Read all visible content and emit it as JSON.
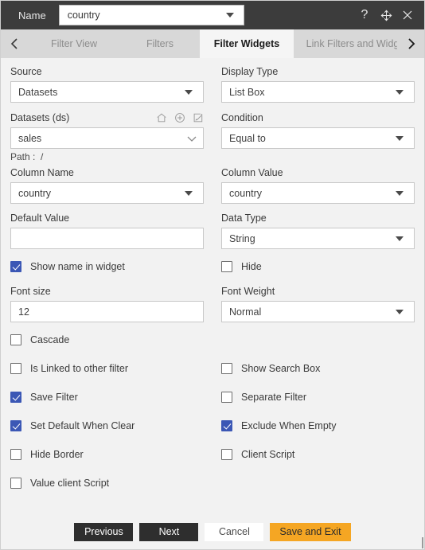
{
  "titlebar": {
    "name_label": "Name",
    "name_value": "country",
    "help_icon": "question-mark-icon",
    "move_icon": "move-arrows-icon",
    "close_icon": "close-icon"
  },
  "tabs": {
    "prev_arrow": "chevron-left-icon",
    "next_arrow": "chevron-right-icon",
    "items": [
      {
        "label": "Filter View",
        "active": false
      },
      {
        "label": "Filters",
        "active": false
      },
      {
        "label": "Filter Widgets",
        "active": true
      },
      {
        "label": "Link Filters and Widge",
        "active": false
      }
    ]
  },
  "form": {
    "source": {
      "label": "Source",
      "value": "Datasets"
    },
    "display_type": {
      "label": "Display Type",
      "value": "List Box"
    },
    "datasets": {
      "label": "Datasets (ds)",
      "value": "sales",
      "path_label": "Path :",
      "path_value": "/",
      "icons": [
        "home-icon",
        "add-circle-icon",
        "edit-icon"
      ]
    },
    "condition": {
      "label": "Condition",
      "value": "Equal to"
    },
    "column_name": {
      "label": "Column Name",
      "value": "country"
    },
    "column_value": {
      "label": "Column Value",
      "value": "country"
    },
    "default_value": {
      "label": "Default Value",
      "value": ""
    },
    "data_type": {
      "label": "Data Type",
      "value": "String"
    },
    "font_size": {
      "label": "Font size",
      "value": "12"
    },
    "font_weight": {
      "label": "Font Weight",
      "value": "Normal"
    }
  },
  "checkboxes": {
    "show_name_in_widget": {
      "label": "Show name in widget",
      "checked": true
    },
    "hide": {
      "label": "Hide",
      "checked": false
    },
    "cascade": {
      "label": "Cascade",
      "checked": false
    },
    "is_linked_to_other_filter": {
      "label": "Is Linked to other filter",
      "checked": false
    },
    "show_search_box": {
      "label": "Show Search Box",
      "checked": false
    },
    "save_filter": {
      "label": "Save Filter",
      "checked": true
    },
    "separate_filter": {
      "label": "Separate Filter",
      "checked": false
    },
    "set_default_when_clear": {
      "label": "Set Default When Clear",
      "checked": true
    },
    "exclude_when_empty": {
      "label": "Exclude When Empty",
      "checked": true
    },
    "hide_border": {
      "label": "Hide Border",
      "checked": false
    },
    "client_script": {
      "label": "Client Script",
      "checked": false
    },
    "value_client_script": {
      "label": "Value client Script",
      "checked": false
    }
  },
  "footer": {
    "previous": "Previous",
    "next": "Next",
    "cancel": "Cancel",
    "save_and_exit": "Save and Exit"
  },
  "colors": {
    "titlebar_bg": "#3c3c3c",
    "tab_bg": "#d8d8d8",
    "active_tab_bg": "#f5f5f5",
    "page_bg": "#f2f2f2",
    "checkbox_checked": "#3b57b5",
    "primary_button": "#2e2e2e",
    "accent_button": "#f5a623"
  }
}
